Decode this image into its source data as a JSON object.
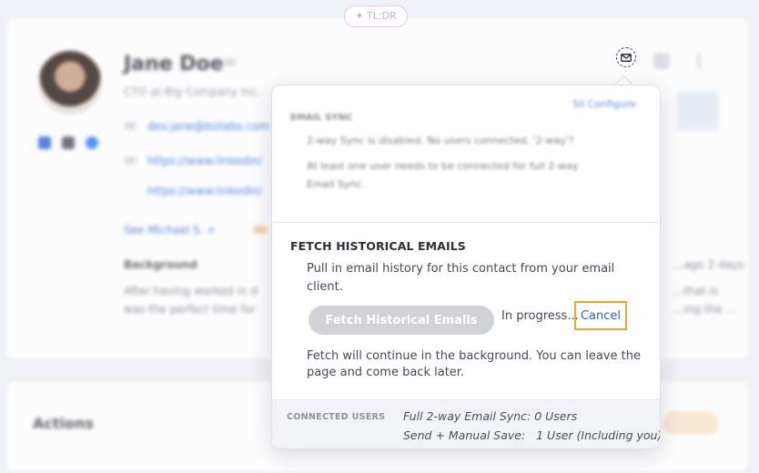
{
  "background": {
    "tldr_label": "✦ TL;DR",
    "contact_name": "Jane Doe",
    "contact_subtitle": "CTO at Big Company Inc.",
    "email_link": "dev.jane@bizlabs.com",
    "linkedin_link": "https://www.linkedin/",
    "linkedin_link2": "https://www.linkedin/",
    "mutual": "See Michael S. +",
    "background_label": "Background",
    "bg_text_1": "After having worked in d",
    "bg_text_2": "was the perfect time for",
    "right_text_1": "...that is",
    "right_text_2": "...ing the ...",
    "right_text_3": "...ago 2 days",
    "actions_title": "Actions"
  },
  "popover": {
    "blurred": {
      "configure_link": "Sil Configure",
      "email_sync_label": "EMAIL SYNC",
      "sync_line_1": "2-way Sync is disabled. No users connected. '2-way'?",
      "sync_line_2": "At least one user needs to be connected for full 2-way",
      "sync_line_3": "Email Sync."
    },
    "fetch_title": "FETCH HISTORICAL EMAILS",
    "fetch_description": "Pull in email history for this contact from your email client.",
    "fetch_button": "Fetch Historical Emails",
    "progress_text": "In progress...",
    "cancel_label": "Cancel",
    "fetch_note": "Fetch will continue in the background. You can leave the page and come back later.",
    "connected_users_label": "CONNECTED USERS",
    "connected_line_1": "Full 2-way Email Sync: 0 Users",
    "connected_line_2": "Send + Manual Save:   1 User (Including you)"
  },
  "colors": {
    "accent_link": "#2f5fb3",
    "highlight": "#f2a030",
    "button_disabled": "#cfd3d8"
  }
}
